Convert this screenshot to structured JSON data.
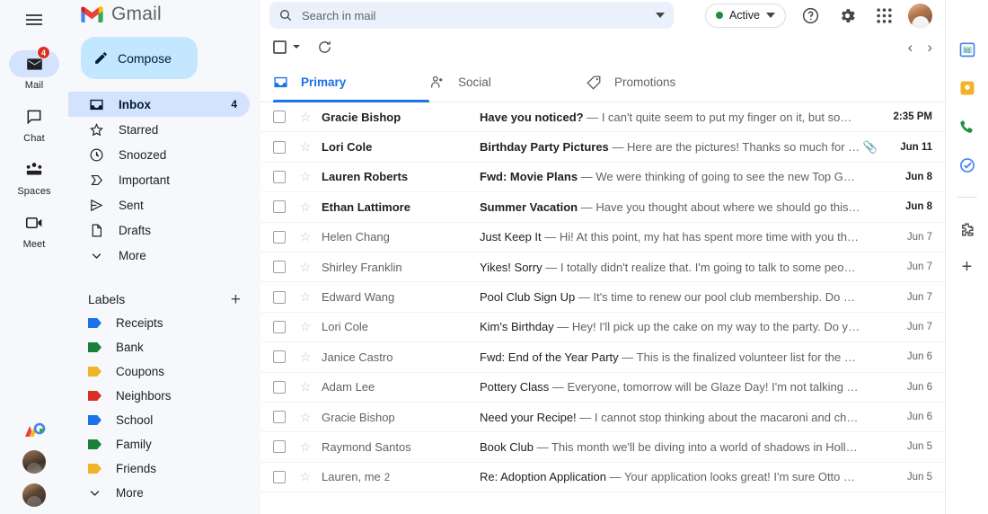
{
  "brand": {
    "name": "Gmail",
    "logo_icon": "gmail-m-logo"
  },
  "rail": {
    "menu_icon": "hamburger-menu-icon",
    "items": [
      {
        "label": "Mail",
        "icon": "mail-icon",
        "badge": "4",
        "active": true
      },
      {
        "label": "Chat",
        "icon": "chat-bubble-icon",
        "badge": "",
        "active": false
      },
      {
        "label": "Spaces",
        "icon": "spaces-people-icon",
        "badge": "",
        "active": false
      },
      {
        "label": "Meet",
        "icon": "meet-video-icon",
        "badge": "",
        "active": false
      }
    ],
    "bottom": [
      {
        "name": "google-colors-icon"
      },
      {
        "name": "contact-avatar-1"
      },
      {
        "name": "contact-avatar-2"
      }
    ]
  },
  "sidebar": {
    "compose": {
      "label": "Compose",
      "icon": "pencil-icon",
      "bg": "#c2e7ff"
    },
    "nav": [
      {
        "label": "Inbox",
        "icon": "inbox-icon",
        "count": "4",
        "active": true
      },
      {
        "label": "Starred",
        "icon": "star-icon",
        "count": "",
        "active": false
      },
      {
        "label": "Snoozed",
        "icon": "clock-icon",
        "count": "",
        "active": false
      },
      {
        "label": "Important",
        "icon": "important-label-icon",
        "count": "",
        "active": false
      },
      {
        "label": "Sent",
        "icon": "send-icon",
        "count": "",
        "active": false
      },
      {
        "label": "Drafts",
        "icon": "draft-file-icon",
        "count": "",
        "active": false
      },
      {
        "label": "More",
        "icon": "chevron-down-icon",
        "count": "",
        "active": false
      }
    ],
    "labels_header": {
      "title": "Labels",
      "add_icon": "plus-icon"
    },
    "labels": [
      {
        "label": "Receipts",
        "color": "#1a73e8"
      },
      {
        "label": "Bank",
        "color": "#188038"
      },
      {
        "label": "Coupons",
        "color": "#f0b429"
      },
      {
        "label": "Neighbors",
        "color": "#d93025"
      },
      {
        "label": "School",
        "color": "#1a73e8"
      },
      {
        "label": "Family",
        "color": "#188038"
      },
      {
        "label": "Friends",
        "color": "#f0b429"
      }
    ],
    "labels_more": {
      "label": "More",
      "icon": "chevron-down-icon"
    }
  },
  "header": {
    "search": {
      "placeholder": "Search in mail",
      "value": "",
      "icon": "search-icon",
      "options_icon": "chevron-down-icon"
    },
    "status": {
      "label": "Active",
      "dot_color": "#1e8e3e",
      "caret_icon": "chevron-down-icon"
    },
    "help_icon": "help-question-icon",
    "settings_icon": "gear-icon",
    "apps_icon": "apps-grid-icon",
    "avatar": "account-avatar"
  },
  "toolbar": {
    "select_all_icon": "checkbox-icon",
    "select_caret_icon": "chevron-down-icon",
    "refresh_icon": "refresh-icon",
    "prev_icon": "chevron-left-icon",
    "next_icon": "chevron-right-icon"
  },
  "tabs": [
    {
      "label": "Primary",
      "icon": "inbox-icon",
      "active": true
    },
    {
      "label": "Social",
      "icon": "social-people-icon",
      "active": false
    },
    {
      "label": "Promotions",
      "icon": "tag-icon",
      "active": false
    }
  ],
  "emails": [
    {
      "sender": "Gracie Bishop",
      "count": "",
      "subject": "Have you noticed?",
      "snippet": "I can't quite seem to put my finger on it, but somethin...",
      "date": "2:35 PM",
      "unread": true,
      "attachment": false
    },
    {
      "sender": "Lori Cole",
      "count": "",
      "subject": "Birthday Party Pictures",
      "snippet": "Here are the pictures! Thanks so much for helpi...",
      "date": "Jun 11",
      "unread": true,
      "attachment": true
    },
    {
      "sender": "Lauren Roberts",
      "count": "",
      "subject": "Fwd: Movie Plans",
      "snippet": "We were thinking of going to see the new Top Gun mo...",
      "date": "Jun 8",
      "unread": true,
      "attachment": false
    },
    {
      "sender": "Ethan Lattimore",
      "count": "",
      "subject": "Summer Vacation",
      "snippet": "Have you thought about where we should go this sum...",
      "date": "Jun 8",
      "unread": true,
      "attachment": false
    },
    {
      "sender": "Helen Chang",
      "count": "",
      "subject": "Just Keep It",
      "snippet": "Hi! At this point, my hat has spent more time with you than w...",
      "date": "Jun 7",
      "unread": false,
      "attachment": false
    },
    {
      "sender": "Shirley Franklin",
      "count": "",
      "subject": "Yikes! Sorry",
      "snippet": "I totally didn't realize that. I'm going to talk to some people a...",
      "date": "Jun 7",
      "unread": false,
      "attachment": false
    },
    {
      "sender": "Edward Wang",
      "count": "",
      "subject": "Pool Club Sign Up",
      "snippet": "It's time to renew our pool club membership. Do you re...",
      "date": "Jun 7",
      "unread": false,
      "attachment": false
    },
    {
      "sender": "Lori Cole",
      "count": "",
      "subject": "Kim's Birthday",
      "snippet": "Hey! I'll pick up the cake on my way to the party. Do you th...",
      "date": "Jun 7",
      "unread": false,
      "attachment": false
    },
    {
      "sender": "Janice Castro",
      "count": "",
      "subject": "Fwd: End of the Year Party",
      "snippet": "This is the finalized volunteer list for the end of...",
      "date": "Jun 6",
      "unread": false,
      "attachment": false
    },
    {
      "sender": "Adam Lee",
      "count": "",
      "subject": "Pottery Class",
      "snippet": "Everyone, tomorrow will be Glaze Day! I'm not talking about...",
      "date": "Jun 6",
      "unread": false,
      "attachment": false
    },
    {
      "sender": "Gracie Bishop",
      "count": "",
      "subject": "Need your Recipe!",
      "snippet": "I cannot stop thinking about the macaroni and cheese...",
      "date": "Jun 6",
      "unread": false,
      "attachment": false
    },
    {
      "sender": "Raymond Santos",
      "count": "",
      "subject": "Book Club",
      "snippet": "This month we'll be diving into a world of shadows in Holly Bla...",
      "date": "Jun 5",
      "unread": false,
      "attachment": false
    },
    {
      "sender": "Lauren, me",
      "count": "2",
      "subject": "Re: Adoption Application",
      "snippet": "Your application looks great! I'm sure Otto would...",
      "date": "Jun 5",
      "unread": false,
      "attachment": false
    }
  ],
  "right_rail": [
    {
      "name": "calendar-icon",
      "color": "#4285f4"
    },
    {
      "name": "keep-icon",
      "color": "#f0b429"
    },
    {
      "name": "contacts-phone-icon",
      "color": "#1e8e3e"
    },
    {
      "name": "tasks-icon",
      "color": "#4285f4"
    },
    {
      "name": "addons-puzzle-icon",
      "color": "#444746"
    },
    {
      "name": "plus-icon",
      "color": "#444746"
    }
  ],
  "separator": " — "
}
